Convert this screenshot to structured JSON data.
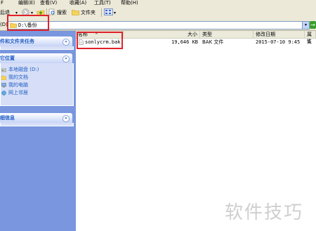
{
  "menubar": {
    "items": [
      "F",
      "编辑(E)",
      "查看(V)",
      "收藏(A)",
      "工具(T)",
      "帮助(H)"
    ]
  },
  "toolbar": {
    "back_label": "后退",
    "search_label": "搜索",
    "folders_label": "文件夹"
  },
  "address": {
    "label": "(D)",
    "path": "D:\\备份"
  },
  "tasks": {
    "file_folder_tasks": "件和文件夹任务",
    "other_places": "它位置",
    "details": "细信息",
    "places": [
      "本地磁盘 (D:)",
      "我的文档",
      "我的电脑",
      "网上邻居"
    ]
  },
  "columns": {
    "name": "名称",
    "size": "大小",
    "type": "类型",
    "modified": "修改日期",
    "attr": "属性"
  },
  "files": [
    {
      "name": "sonlycrm.bak",
      "size": "19,646 KB",
      "type": "BAK 文件",
      "modified": "2015-07-10  9:45",
      "attr": "A"
    }
  ],
  "watermark": "软件技巧",
  "colors": {
    "highlight": "#e0212b",
    "taskpane_bg": "#7a96df",
    "taskpane_text": "#215dc6"
  }
}
